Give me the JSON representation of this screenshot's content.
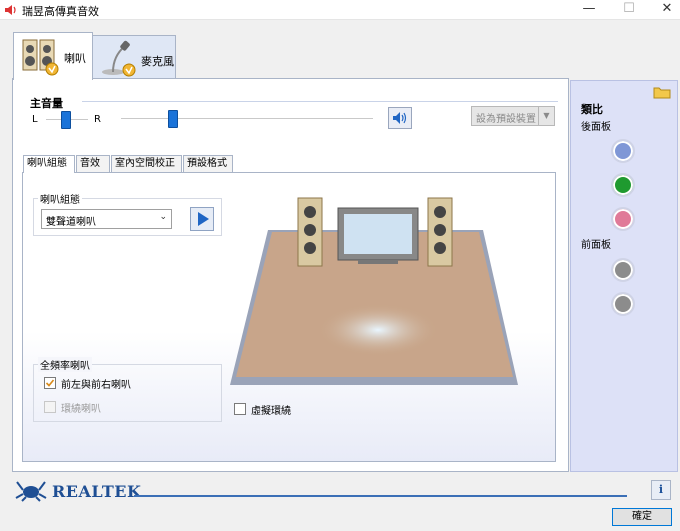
{
  "window": {
    "title": "瑞昱高傳真音效",
    "min_glyph": "—",
    "max_glyph": "☐",
    "close_glyph": "✕"
  },
  "tabs": [
    {
      "label": "喇叭",
      "active": true
    },
    {
      "label": "麥克風",
      "active": false
    }
  ],
  "volume": {
    "label": "主音量",
    "left": "L",
    "right": "R",
    "default_device_label": "設為預設裝置",
    "default_device_arrow": "▼"
  },
  "subtabs": [
    "喇叭組態",
    "音效",
    "室內空間校正",
    "預設格式"
  ],
  "config": {
    "legend": "喇叭組態",
    "selected": "雙聲道喇叭"
  },
  "fullrange": {
    "legend": "全頻率喇叭",
    "front": {
      "label": "前左與前右喇叭",
      "checked": true
    },
    "surround": {
      "label": "環繞喇叭",
      "checked": false,
      "disabled": true
    }
  },
  "virtual_surround": {
    "label": "虛擬環繞",
    "checked": false
  },
  "side": {
    "title": "類比",
    "back": "後面板",
    "front": "前面板",
    "jack_colors": {
      "blue": "#7f97d6",
      "green": "#1f9a2f",
      "pink": "#e07a98",
      "gray": "#8c8c8c"
    }
  },
  "footer": {
    "brand": "REALTEK",
    "info": "i",
    "ok": "確定"
  },
  "colors": {
    "accent": "#1a73d9",
    "panel_border": "#a9b4c7"
  }
}
